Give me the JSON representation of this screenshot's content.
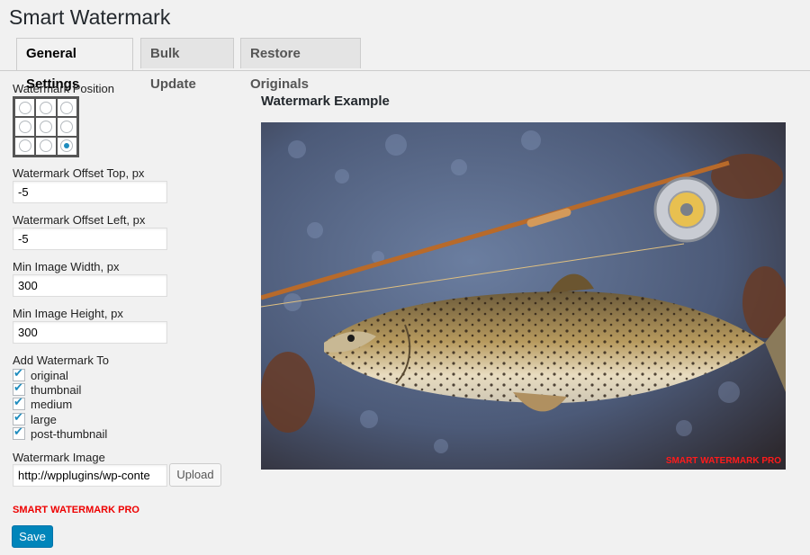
{
  "page": {
    "title": "Smart Watermark"
  },
  "tabs": [
    {
      "label": "General Settings",
      "active": true
    },
    {
      "label": "Bulk Update",
      "active": false
    },
    {
      "label": "Restore Originals",
      "active": false
    }
  ],
  "form": {
    "position_label": "Watermark Position",
    "position_selected": "bottom-right",
    "offset_top_label": "Watermark Offset Top, px",
    "offset_top_value": "-5",
    "offset_left_label": "Watermark Offset Left, px",
    "offset_left_value": "-5",
    "min_width_label": "Min Image Width, px",
    "min_width_value": "300",
    "min_height_label": "Min Image Height, px",
    "min_height_value": "300",
    "add_to_label": "Add Watermark To",
    "add_to_items": [
      {
        "label": "original",
        "checked": true
      },
      {
        "label": "thumbnail",
        "checked": true
      },
      {
        "label": "medium",
        "checked": true
      },
      {
        "label": "large",
        "checked": true
      },
      {
        "label": "post-thumbnail",
        "checked": true
      }
    ],
    "image_label": "Watermark Image",
    "image_value": "http://wpplugins/wp-conte",
    "upload_label": "Upload",
    "watermark_preview_text": "SMART WATERMARK PRO",
    "save_label": "Save"
  },
  "example": {
    "title": "Watermark Example",
    "watermark_text": "SMART WATERMARK PRO"
  },
  "colors": {
    "accent": "#0085ba",
    "watermark": "#ff1b1b"
  }
}
